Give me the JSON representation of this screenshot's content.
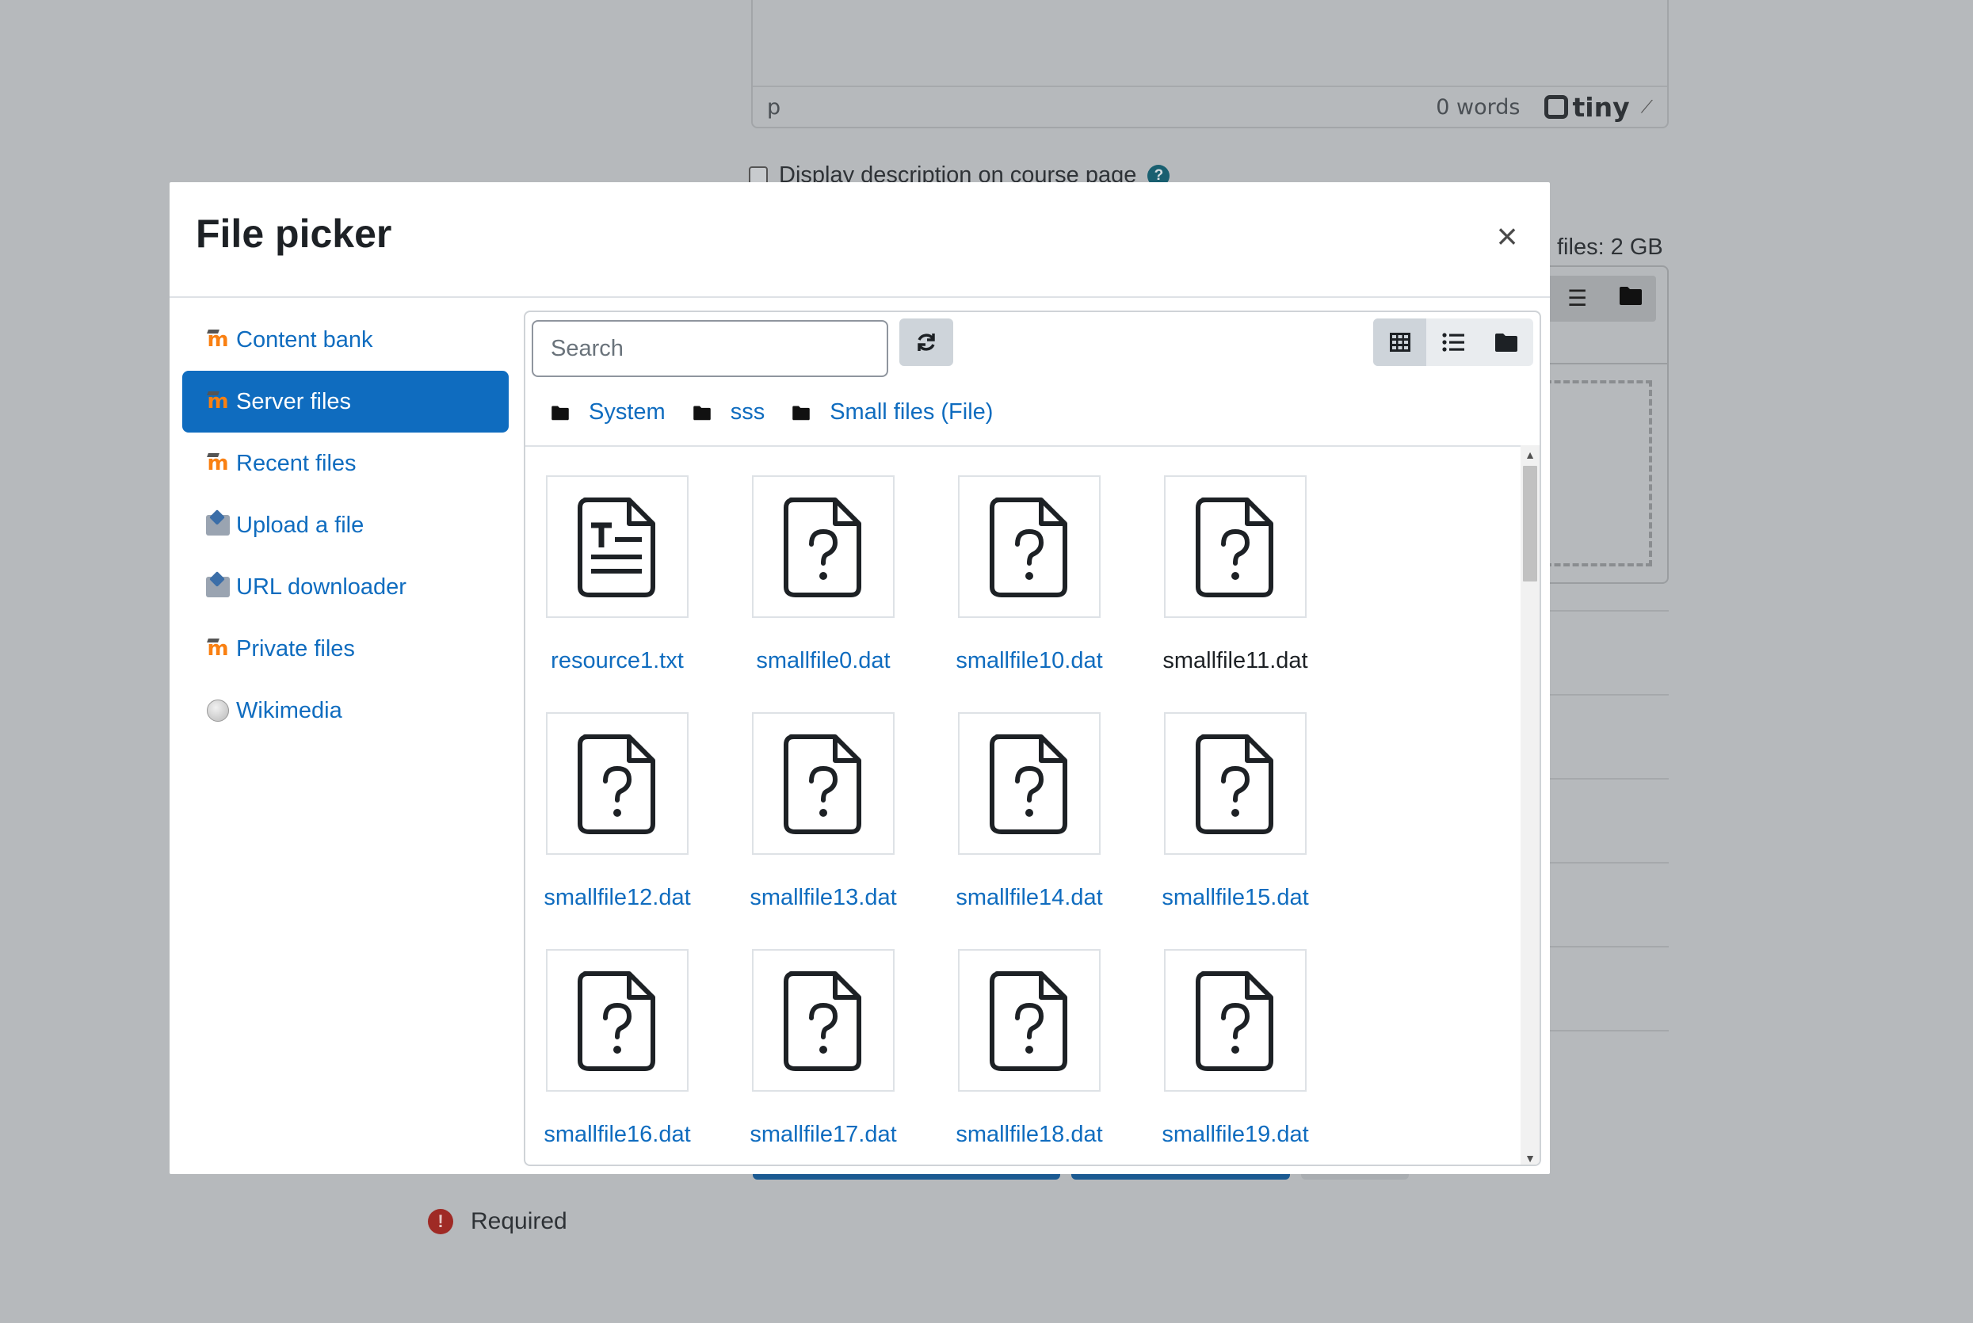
{
  "background": {
    "editor_status": {
      "path": "p",
      "words": "0 words",
      "brand": "tiny"
    },
    "display_description_label": "Display description on course page",
    "max_size_text": "files: 2 GB",
    "required_label": "Required"
  },
  "modal": {
    "title": "File picker",
    "close_label": "×"
  },
  "sidebar": {
    "items": [
      {
        "label": "Content bank",
        "icon": "moodle-icon",
        "active": false
      },
      {
        "label": "Server files",
        "icon": "moodle-icon",
        "active": true
      },
      {
        "label": "Recent files",
        "icon": "moodle-icon",
        "active": false
      },
      {
        "label": "Upload a file",
        "icon": "upload-icon",
        "active": false
      },
      {
        "label": "URL downloader",
        "icon": "upload-icon",
        "active": false
      },
      {
        "label": "Private files",
        "icon": "moodle-icon",
        "active": false
      },
      {
        "label": "Wikimedia",
        "icon": "wikipedia-globe-icon",
        "active": false
      }
    ]
  },
  "toolbar": {
    "search_placeholder": "Search",
    "refresh_icon": "refresh-icon",
    "views": [
      "grid-view-icon",
      "list-view-icon",
      "folder-view-icon"
    ]
  },
  "breadcrumb": [
    "System",
    "sss",
    "Small files (File)"
  ],
  "files": [
    {
      "name": "resource1.txt",
      "icon": "text-file-icon"
    },
    {
      "name": "smallfile0.dat",
      "icon": "unknown-file-icon"
    },
    {
      "name": "smallfile10.dat",
      "icon": "unknown-file-icon"
    },
    {
      "name": "smallfile11.dat",
      "icon": "unknown-file-icon"
    },
    {
      "name": "smallfile12.dat",
      "icon": "unknown-file-icon"
    },
    {
      "name": "smallfile13.dat",
      "icon": "unknown-file-icon"
    },
    {
      "name": "smallfile14.dat",
      "icon": "unknown-file-icon"
    },
    {
      "name": "smallfile15.dat",
      "icon": "unknown-file-icon"
    },
    {
      "name": "smallfile16.dat",
      "icon": "unknown-file-icon"
    },
    {
      "name": "smallfile17.dat",
      "icon": "unknown-file-icon"
    },
    {
      "name": "smallfile18.dat",
      "icon": "unknown-file-icon"
    },
    {
      "name": "smallfile19.dat",
      "icon": "unknown-file-icon"
    }
  ],
  "colors": {
    "accent": "#0f6cbf",
    "overlay": "#b6b9bc",
    "moodle_orange": "#f98012",
    "required_red": "#9f2a25"
  }
}
